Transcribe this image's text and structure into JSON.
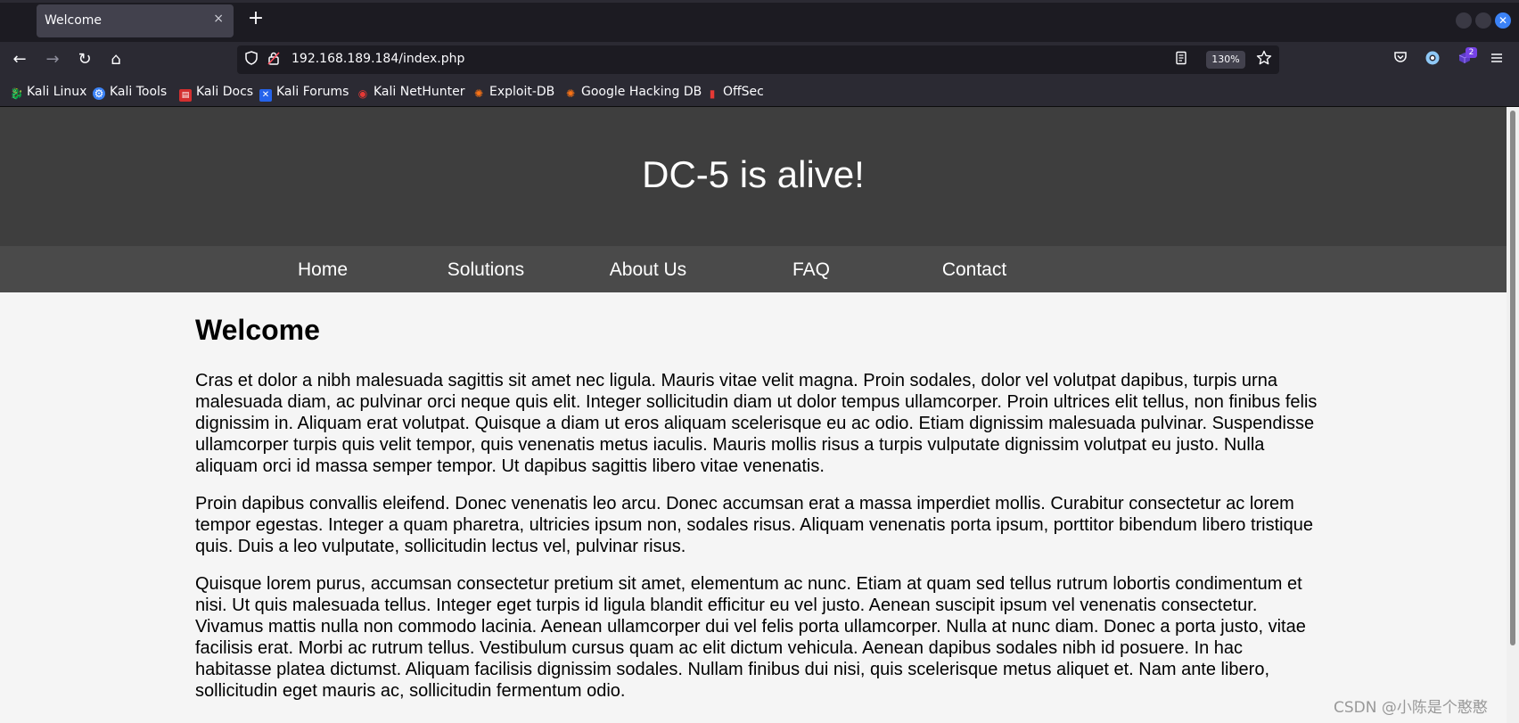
{
  "browser": {
    "tab": {
      "title": "Welcome",
      "close": "×"
    },
    "new_tab": "+",
    "window_close": "✕",
    "nav": {
      "back": "←",
      "forward": "→",
      "reload": "↻",
      "home": "⌂"
    },
    "url": "192.168.189.184/index.php",
    "zoom": "130%",
    "extension_badge": "2",
    "bookmarks": [
      {
        "label": "Kali Linux"
      },
      {
        "label": "Kali Tools"
      },
      {
        "label": "Kali Docs"
      },
      {
        "label": "Kali Forums"
      },
      {
        "label": "Kali NetHunter"
      },
      {
        "label": "Exploit-DB"
      },
      {
        "label": "Google Hacking DB"
      },
      {
        "label": "OffSec"
      }
    ],
    "icons": {
      "lock": "lock-icon",
      "shield": "shield-icon",
      "reader": "reader-view-icon",
      "star": "bookmark-star-icon",
      "pocket": "pocket-icon",
      "account": "account-icon",
      "extensions": "extensions-icon",
      "menu": "hamburger-menu-icon"
    }
  },
  "site": {
    "title": "DC-5 is alive!",
    "nav": [
      "Home",
      "Solutions",
      "About Us",
      "FAQ",
      "Contact"
    ],
    "heading": "Welcome",
    "paragraphs": [
      "Cras et dolor a nibh malesuada sagittis sit amet nec ligula. Mauris vitae velit magna. Proin sodales, dolor vel volutpat dapibus, turpis urna malesuada diam, ac pulvinar orci neque quis elit. Integer sollicitudin diam ut dolor tempus ullamcorper. Proin ultrices elit tellus, non finibus felis dignissim in. Aliquam erat volutpat. Quisque a diam ut eros aliquam scelerisque eu ac odio. Etiam dignissim malesuada pulvinar. Suspendisse ullamcorper turpis quis velit tempor, quis venenatis metus iaculis. Mauris mollis risus a turpis vulputate dignissim volutpat eu justo. Nulla aliquam orci id massa semper tempor. Ut dapibus sagittis libero vitae venenatis.",
      "Proin dapibus convallis eleifend. Donec venenatis leo arcu. Donec accumsan erat a massa imperdiet mollis. Curabitur consectetur ac lorem tempor egestas. Integer a quam pharetra, ultricies ipsum non, sodales risus. Aliquam venenatis porta ipsum, porttitor bibendum libero tristique quis. Duis a leo vulputate, sollicitudin lectus vel, pulvinar risus.",
      "Quisque lorem purus, accumsan consectetur pretium sit amet, elementum ac nunc. Etiam at quam sed tellus rutrum lobortis condimentum et nisi. Ut quis malesuada tellus. Integer eget turpis id ligula blandit efficitur eu vel justo. Aenean suscipit ipsum vel venenatis consectetur. Vivamus mattis nulla non commodo lacinia. Aenean ullamcorper dui vel felis porta ullamcorper. Nulla at nunc diam. Donec a porta justo, vitae facilisis erat. Morbi ac rutrum tellus. Vestibulum cursus quam ac elit dictum vehicula. Aenean dapibus sodales nibh id posuere. In hac habitasse platea dictumst. Aliquam facilisis dignissim sodales. Nullam finibus dui nisi, quis scelerisque metus aliquet et. Nam ante libero, sollicitudin eget mauris ac, sollicitudin fermentum odio."
    ]
  },
  "watermark": "CSDN @小陈是个憨憨",
  "colors": {
    "header_bg": "#3e3e3e",
    "nav_bg": "#4a4a4a",
    "page_bg": "#f5f5f5",
    "chrome_bg": "#2b2a33"
  }
}
